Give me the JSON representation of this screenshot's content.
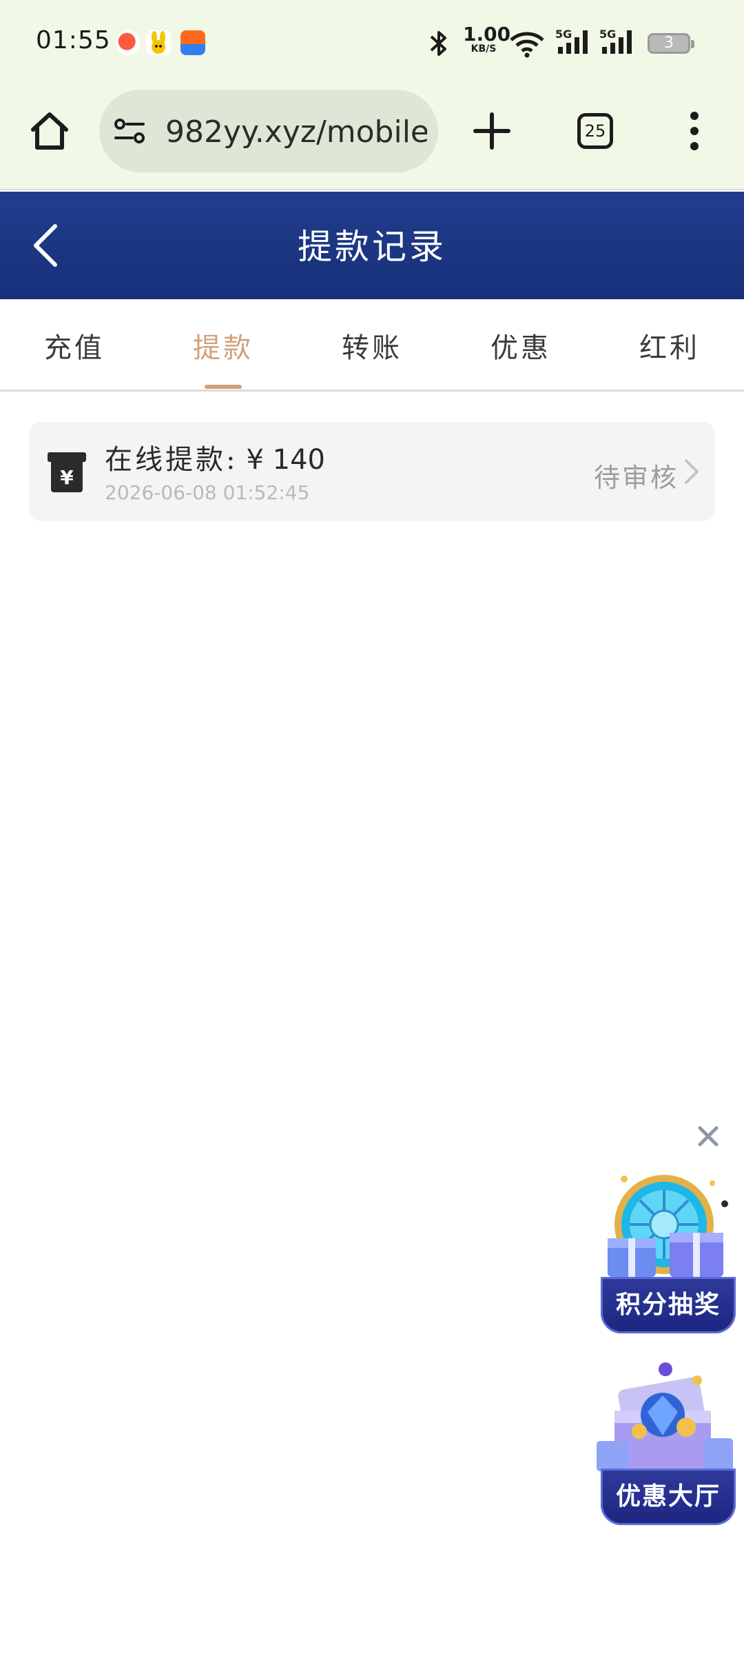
{
  "status_bar": {
    "time": "01:55",
    "net_speed_value": "1.00",
    "net_speed_unit": "KB/S",
    "signal_1_label": "5G",
    "signal_2_label": "5G",
    "battery_level": "3"
  },
  "browser": {
    "url": "982yy.xyz/mobile/",
    "tab_count": "25"
  },
  "header": {
    "title": "提款记录"
  },
  "tabs": [
    {
      "label": "充值",
      "active": false
    },
    {
      "label": "提款",
      "active": true
    },
    {
      "label": "转账",
      "active": false
    },
    {
      "label": "优惠",
      "active": false
    },
    {
      "label": "红利",
      "active": false
    }
  ],
  "records": [
    {
      "type_label": "在线提款:",
      "amount": "¥ 140",
      "timestamp": "2026-06-08 01:52:45",
      "status": "待审核"
    }
  ],
  "floating": {
    "lottery_label": "积分抽奖",
    "hall_label": "优惠大厅"
  },
  "colors": {
    "header_bg": "#1b3682",
    "active_tab": "#d2a079",
    "status_bar_bg": "#f1f8e6",
    "promo_label_bg": "#232d88"
  }
}
